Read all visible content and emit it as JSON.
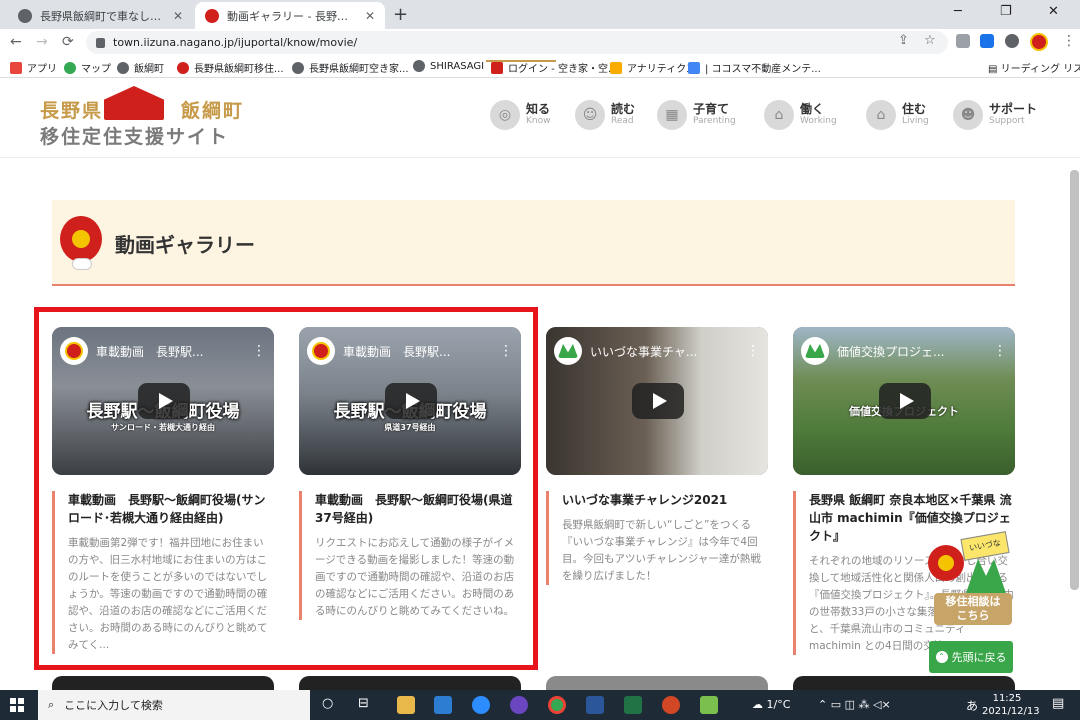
{
  "browser": {
    "tabs": [
      {
        "title": "長野県飯綱町で車なしの生活はで",
        "active": false
      },
      {
        "title": "動画ギャラリー - 長野県飯綱町移住",
        "active": true
      }
    ],
    "new_tab": "+",
    "window_controls": [
      "─",
      "❐",
      "✕"
    ],
    "url": "town.iizuna.nagano.jp/ijuportal/know/movie/",
    "nav": {
      "back": "←",
      "forward": "→",
      "reload": "⟳"
    },
    "omnibox_icons": {
      "share": "⇪",
      "star": "☆"
    },
    "menu": "⋮",
    "bookmarks": [
      {
        "label": "アプリ",
        "color": "#e8453c"
      },
      {
        "label": "マップ",
        "color": "#34a853"
      },
      {
        "label": "飯綱町",
        "color": "#5f6368"
      },
      {
        "label": "長野県飯綱町移住...",
        "color": "#d0201b"
      },
      {
        "label": "長野県飯綱町空き家...",
        "color": "#5f6368"
      },
      {
        "label": "SHIRASAGI",
        "color": "#5f6368"
      },
      {
        "label": "ログイン - 空き家・空...",
        "color": "#d0201b"
      },
      {
        "label": "アナリティクス",
        "color": "#f9ab00"
      },
      {
        "label": "| ココスマ不動産メンテ...",
        "color": "#4285f4"
      }
    ],
    "reading_list": "リーディング リスト"
  },
  "site": {
    "logo_top_left": "長野県",
    "logo_top_right": "飯綱町",
    "logo_sub": "移住定住支援サイト",
    "nav": [
      {
        "ja": "知る",
        "en": "Know",
        "icon": "magnifier-icon"
      },
      {
        "ja": "読む",
        "en": "Read",
        "icon": "reader-icon"
      },
      {
        "ja": "子育て",
        "en": "Parenting",
        "icon": "blocks-icon"
      },
      {
        "ja": "働く",
        "en": "Working",
        "icon": "desk-icon"
      },
      {
        "ja": "住む",
        "en": "Living",
        "icon": "house-icon"
      },
      {
        "ja": "サポート",
        "en": "Support",
        "icon": "person-icon"
      }
    ],
    "page_title": "動画ギャラリー"
  },
  "videos": [
    {
      "video_title": "車載動画　長野駅...",
      "overlay_big": "長野駅〜飯綱町役場",
      "overlay_small": "サンロード・若槻大通り経由",
      "title": "車載動画　長野駅〜飯綱町役場(サンロード･若槻大通り経由経由)",
      "desc": "車載動画第2弾です！福井団地にお住まいの方や、旧三水村地域にお住まいの方はこのルートを使うことが多いのではないでしょうか。等速の動画ですので通勤時間の確認や、沿道のお店の確認などにご活用ください。お時間のある時にのんびりと眺めてみてく...",
      "channel": "apple"
    },
    {
      "video_title": "車載動画　長野駅...",
      "overlay_big": "長野駅〜飯綱町役場",
      "overlay_small": "県道37号経由",
      "title": "車載動画　長野駅〜飯綱町役場(県道37号経由)",
      "desc": "リクエストにお応えして通勤の様子がイメージできる動画を撮影しました！等速の動画ですので通勤時間の確認や、沿道のお店の確認などにご活用ください。お時間のある時にのんびりと眺めてみてくださいね。",
      "channel": "apple"
    },
    {
      "video_title": "いいづな事業チャ...",
      "overlay_big": "",
      "overlay_small": "",
      "title": "いいづな事業チャレンジ2021",
      "desc": "長野県飯綱町で新しい“しごと”をつくる『いいづな事業チャレンジ』は今年で4回目。今回もアツいチャレンジャー達が熱戦を繰り広げました！",
      "channel": "green"
    },
    {
      "video_title": "価値交換プロジェ...",
      "overlay_big": "",
      "overlay_small": "価値交換プロジェクト",
      "title": "長野県 飯綱町 奈良本地区×千葉県 流山市 machimin『価値交換プロジェクト』",
      "desc": "それぞれの地域のリソースを活かし合い交換して地域活性化と関係人口の創出をする『価値交換プロジェクト』。長野県飯綱町内の世帯数33戸の小さな集落・奈良本地区と、千葉県流山市のコミュニティmachimin との4日間の交流...",
      "channel": "green"
    }
  ],
  "widgets": {
    "consult_flag": "いいづな",
    "consult_label": "移住相談は\nこちら",
    "to_top": "先頭に戻る",
    "to_top_arrow": "⌃"
  },
  "taskbar": {
    "search_placeholder": "ここに入力して検索",
    "search_icon": "⌕",
    "task_icons": [
      "○",
      "⊟"
    ],
    "weather": "1/°C",
    "tray_icons": "⌃  ▭  ◫  ⁂  ◁×",
    "ime": "あ",
    "time": "11:25",
    "date": "2021/12/13",
    "notification_icon": "▤"
  }
}
